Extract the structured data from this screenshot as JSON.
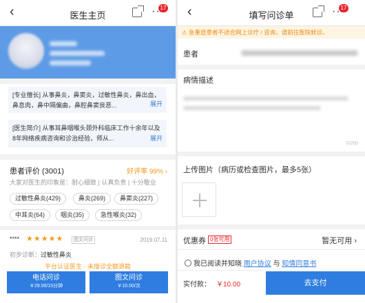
{
  "left": {
    "nav": {
      "back": "‹",
      "title": "医生主页",
      "more": "···",
      "badge": "17"
    },
    "intro": {
      "specialty_text": "[专业擅长] 从事鼻炎，鼻窦炎，过敏性鼻炎，鼻出血，鼻息肉，鼻中隔偏曲，鼻腔鼻窦良恶...",
      "profile_text": "[医生简介] 从事耳鼻咽喉头颈外科临床工作十余年以及8年网络疾病咨询和诊治经验，师从...",
      "expand": "展开"
    },
    "reviews": {
      "title": "患者评价 (3001)",
      "good_rate": "好评率 99% ›",
      "impression": "大家对医生的印象是：耐心细致 | 认真负责 | 十分敬业",
      "tags": [
        "过敏性鼻炎(429)",
        "鼻炎(269)",
        "鼻窦炎(227)",
        "中耳炎(64)",
        "咽炎(35)",
        "急性喉炎(32)"
      ],
      "item": {
        "user": "****",
        "stars": "★★★★★",
        "source": "图文问诊",
        "date": "2019.07.11",
        "diagnosis_label": "初步诊断：",
        "diagnosis_value": "过敏性鼻炎"
      }
    },
    "guarantee": "平台认证医生 · 未接诊全额退款",
    "buttons": {
      "phone": {
        "label": "电话问诊",
        "price": "￥29.00/15分钟"
      },
      "text": {
        "label": "图文问诊",
        "price": "￥10.00/次"
      }
    }
  },
  "right": {
    "nav": {
      "back": "‹",
      "title": "填写问诊单",
      "more": "···",
      "badge": "17"
    },
    "warning": "急重症患者不适合网上诊疗 / 咨询，请前往医院就诊。",
    "patient_label": "患者",
    "condition_label": "病情描述",
    "counter": "0/200",
    "upload_label": "上传图片（病历或检查图片，最多5张）",
    "coupon_label": "优惠券",
    "coupon_tag": "0张可用",
    "coupon_value": "暂无可用 ›",
    "agree": {
      "prefix": "我已阅读并知晓",
      "link1": "用户协议",
      "and": "与",
      "link2": "知情同意书"
    },
    "pay_label": "实付款：",
    "pay_amount": "￥10.00",
    "pay_button": "去支付"
  },
  "colors": {
    "accent": "#2f7de0",
    "warning": "#f39a1e",
    "danger": "#e8262b",
    "hero": "#5e9be6"
  }
}
